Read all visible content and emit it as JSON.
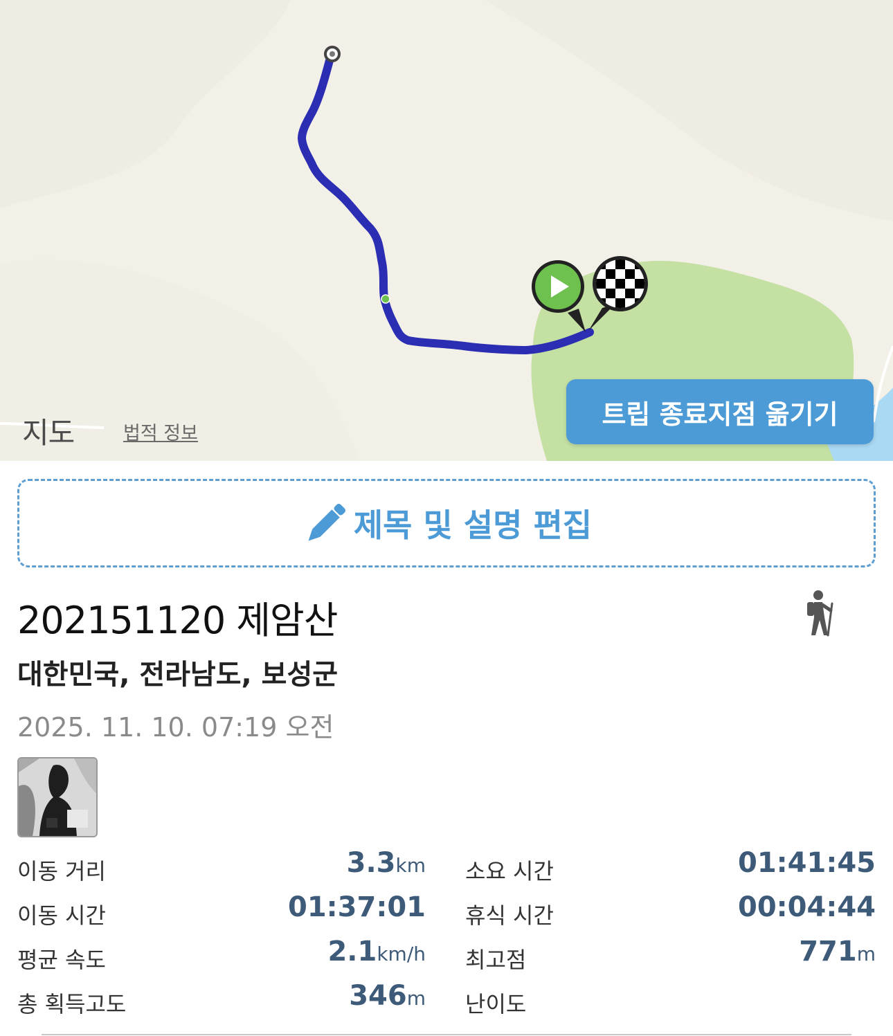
{
  "map": {
    "attribution_glyph": "",
    "attribution_text": "지도",
    "legal_link": "법적 정보",
    "move_end_button": "트립 종료지점 옮기기",
    "colors": {
      "track": "#2b2db2",
      "park": "#c4e0a3",
      "water": "#a9d9f3",
      "land": "#f3f0e8",
      "start_marker": "#6ec04f"
    }
  },
  "edit": {
    "label": "제목 및 설명 편집",
    "icon": "pencil-icon"
  },
  "trip": {
    "title": "202151120 제암산",
    "activity_icon": "hiker-icon",
    "location": "대한민국, 전라남도, 보성군",
    "datetime": "2025. 11. 10. 07:19 오전"
  },
  "stats": {
    "distance": {
      "label": "이동 거리",
      "value": "3.3",
      "unit": "km"
    },
    "total_time": {
      "label": "소요 시간",
      "value": "01:41:45",
      "unit": ""
    },
    "moving_time": {
      "label": "이동 시간",
      "value": "01:37:01",
      "unit": ""
    },
    "rest_time": {
      "label": "휴식 시간",
      "value": "00:04:44",
      "unit": ""
    },
    "avg_speed": {
      "label": "평균 속도",
      "value": "2.1",
      "unit": "km/h"
    },
    "max_elevation": {
      "label": "최고점",
      "value": "771",
      "unit": "m"
    },
    "elevation_gain": {
      "label": "총 획득고도",
      "value": "346",
      "unit": "m"
    },
    "difficulty": {
      "label": "난이도",
      "value": "",
      "unit": ""
    }
  }
}
